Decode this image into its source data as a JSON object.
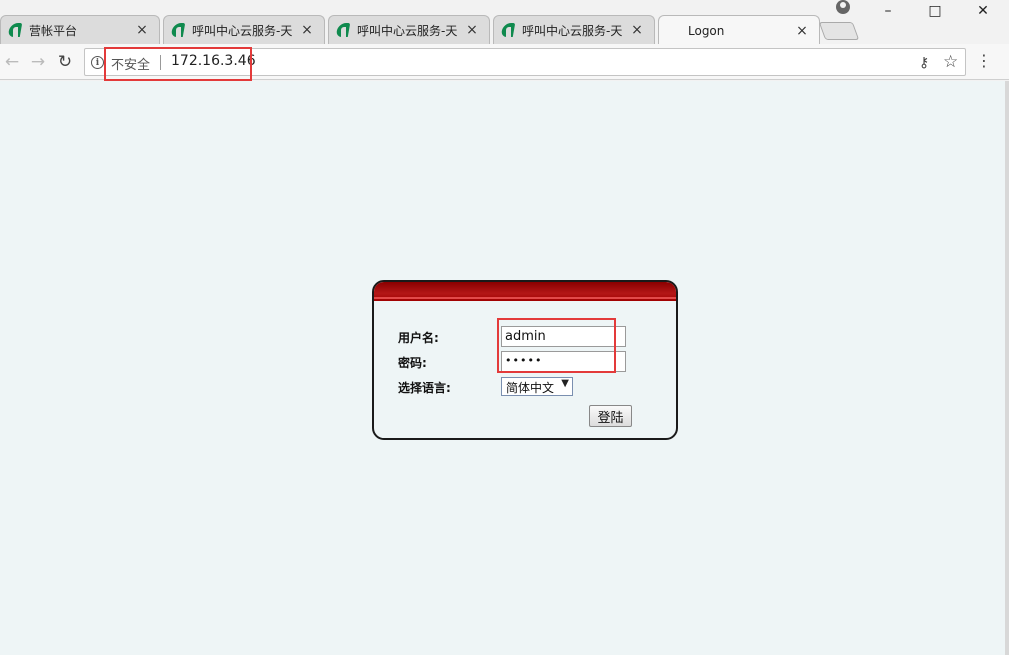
{
  "browser": {
    "tabs": [
      {
        "title": "营帐平台",
        "icon": "brand-logo-icon",
        "close": "×"
      },
      {
        "title": "呼叫中心云服务-天",
        "icon": "brand-logo-icon",
        "close": "×"
      },
      {
        "title": "呼叫中心云服务-天",
        "icon": "brand-logo-icon",
        "close": "×"
      },
      {
        "title": "呼叫中心云服务-天",
        "icon": "brand-logo-icon",
        "close": "×"
      },
      {
        "title": "Logon",
        "icon": "page-icon",
        "close": "×"
      }
    ],
    "window_buttons": {
      "minimize": "–",
      "maximize": "□",
      "close": "✕"
    },
    "security_label": "不安全",
    "url": "172.16.3.46",
    "nav": {
      "back": "←",
      "forward": "→",
      "reload": "↻"
    },
    "icons": {
      "key": "key-icon",
      "star": "star-icon",
      "menu": "menu-icon"
    },
    "star_glyph": "☆",
    "key_glyph": "⚷",
    "menu_glyph": "⋮",
    "info_glyph": "i"
  },
  "login": {
    "username_label": "用户名:",
    "username_value": "admin",
    "password_label": "密码:",
    "password_value": "•••••",
    "language_label": "选择语言:",
    "language_selected": "简体中文",
    "language_arrow": "▼",
    "submit_label": "登陆"
  },
  "colors": {
    "header_red": "#b41717",
    "highlight": "#e33a3a",
    "page_bg": "#eef5f6"
  }
}
